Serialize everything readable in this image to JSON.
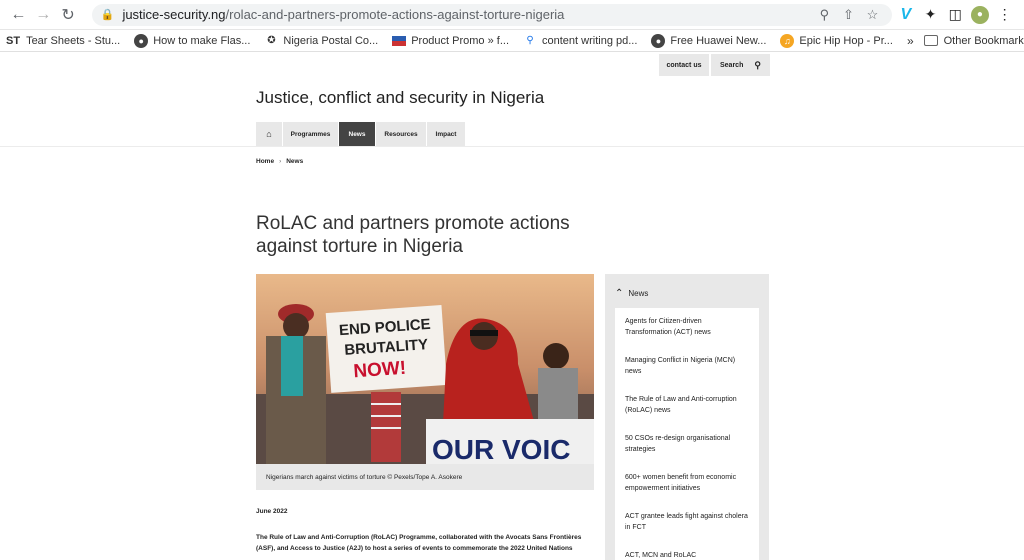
{
  "browser": {
    "url_host": "justice-security.ng",
    "url_path": "/rolac-and-partners-promote-actions-against-torture-nigeria",
    "bookmarks": [
      {
        "label": "Tear Sheets - Stu...",
        "icon": "st-text-icon"
      },
      {
        "label": "How to make Flas...",
        "icon": "globe-icon"
      },
      {
        "label": "Nigeria Postal Co...",
        "icon": "postal-icon"
      },
      {
        "label": "Product Promo » f...",
        "icon": "flag-icon"
      },
      {
        "label": "content writing pd...",
        "icon": "search-icon"
      },
      {
        "label": "Free Huawei New...",
        "icon": "globe-icon"
      },
      {
        "label": "Epic Hip Hop - Pr...",
        "icon": "hiphop-icon"
      }
    ],
    "bookmarks_st": "ST",
    "other_bookmarks": "Other Bookmarks"
  },
  "utility": {
    "contact": "contact us",
    "search": "Search"
  },
  "site_title": "Justice, conflict and security in Nigeria",
  "nav": {
    "programmes": "Programmes",
    "news": "News",
    "resources": "Resources",
    "impact": "Impact"
  },
  "breadcrumb": {
    "home": "Home",
    "sep": "›",
    "current": "News"
  },
  "article": {
    "title": "RoLAC and partners promote actions against torture in Nigeria",
    "image_sign_text": [
      "END POLICE",
      "BRUTALITY",
      "NOW!"
    ],
    "image_banner_text": "OUR VOIC",
    "caption": "Nigerians march against victims of torture © Pexels/Tope A. Asokere",
    "date": "June 2022",
    "body": "The Rule of Law and Anti-Corruption (RoLAC) Programme, collaborated with the Avocats Sans Frontières (ASF), and Access to Justice (A2J) to host a series of events to commemorate the 2022 United Nations"
  },
  "sidebar": {
    "heading": "News",
    "items": [
      "Agents for Citizen-driven Transformation (ACT) news",
      "Managing Conflict in Nigeria (MCN) news",
      "The Rule of Law and Anti-corruption (RoLAC) news",
      "50 CSOs re-design organisational strategies",
      "600+ women benefit from economic empowerment initiatives",
      "ACT grantee leads fight against cholera in FCT",
      "ACT, MCN and RoLAC"
    ]
  }
}
